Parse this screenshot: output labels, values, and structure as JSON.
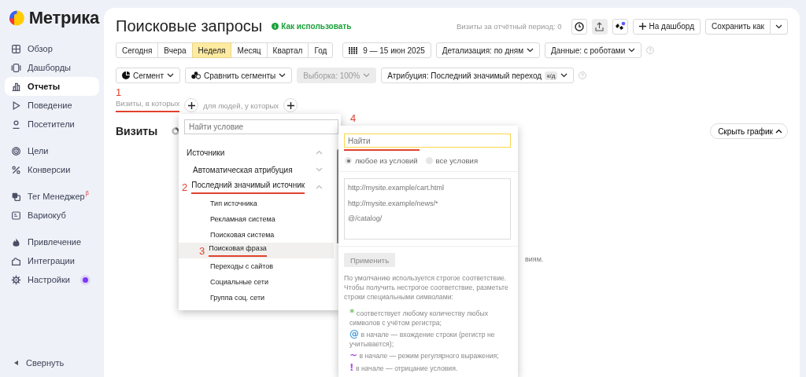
{
  "sidebar": {
    "logo": "Метрика",
    "groups": [
      [
        {
          "label": "Обзор",
          "selected": false,
          "dot": false
        },
        {
          "label": "Дашборды",
          "selected": false,
          "dot": false
        },
        {
          "label": "Отчеты",
          "selected": true,
          "dot": false
        },
        {
          "label": "Поведение",
          "selected": false,
          "dot": false
        },
        {
          "label": "Посетители",
          "selected": false,
          "dot": false
        }
      ],
      [
        {
          "label": "Цели",
          "selected": false,
          "dot": false
        },
        {
          "label": "Конверсии",
          "selected": false,
          "dot": false
        }
      ],
      [
        {
          "label": "Тег Менеджер",
          "selected": false,
          "badge": "β",
          "dot": false
        },
        {
          "label": "Вариокуб",
          "selected": false,
          "dot": false
        }
      ],
      [
        {
          "label": "Привлечение",
          "selected": false,
          "dot": false
        },
        {
          "label": "Интеграции",
          "selected": false,
          "dot": false
        },
        {
          "label": "Настройки",
          "selected": false,
          "dot": true
        }
      ]
    ],
    "collapse": "Свернуть"
  },
  "header": {
    "title": "Поисковые запросы",
    "help_link": "Как использовать",
    "visits_summary": "Визиты за отчётный период: 0",
    "tools": [
      {
        "active": false
      },
      {
        "active": true
      },
      {
        "active": false
      }
    ],
    "add_to_dashboard": "На дашборд",
    "save_as": "Сохранить как"
  },
  "periods": [
    {
      "label": "Сегодня",
      "selected": false
    },
    {
      "label": "Вчера",
      "selected": false
    },
    {
      "label": "Неделя",
      "selected": true
    },
    {
      "label": "Месяц",
      "selected": false
    },
    {
      "label": "Квартал",
      "selected": false
    },
    {
      "label": "Год",
      "selected": false
    }
  ],
  "date_range": "9 — 15 июн 2025",
  "filters": [
    "Детализация: по дням",
    "Данные: с роботами"
  ],
  "segment_bar": [
    {
      "label": "Сегмент",
      "disabled": false
    },
    {
      "label": "Сравнить сегменты",
      "disabled": false
    },
    {
      "label": "Выборка: 100%",
      "disabled": true
    },
    {
      "label": "Атрибуция: Последний значимый переход",
      "disabled": false,
      "badge": "к/д"
    }
  ],
  "conditions": {
    "annotation": "1",
    "visits_label": "Визиты, в которых",
    "people_label": "для людей, у которых"
  },
  "section": {
    "title": "Визиты",
    "hide_chart": "Скрыть график",
    "note": "виям."
  },
  "condition_menu": {
    "search_placeholder": "Найти условие",
    "items": [
      {
        "label": "Источники",
        "expanded": true,
        "children": [
          {
            "label": "Автоматическая атрибуция",
            "expanded": false
          },
          {
            "label": "Последний значимый источник",
            "expanded": true,
            "annotation": "2",
            "children": [
              {
                "label": "Тип источника",
                "selected": false
              },
              {
                "label": "Рекламная система",
                "selected": false
              },
              {
                "label": "Поисковая система",
                "selected": false
              },
              {
                "label": "Поисковая фраза",
                "selected": true,
                "annotation": "3"
              },
              {
                "label": "Переходы с сайтов",
                "selected": false
              },
              {
                "label": "Социальные сети",
                "selected": false
              },
              {
                "label": "Группа соц. сети",
                "selected": false
              }
            ]
          }
        ]
      }
    ]
  },
  "filter_panel": {
    "annotation": "4",
    "search_placeholder": "Найти",
    "match_modes": [
      {
        "label": "любое из условий",
        "selected": true
      },
      {
        "label": "все условия",
        "selected": false
      }
    ],
    "values_placeholder": "http://mysite.example/cart.html\nhttp://mysite.example/news/*\n@/catalog/",
    "apply": "Применить",
    "apply_disabled": true,
    "help": "По умолчанию используется строгое соответствие. Чтобы получить нестрогое соответствие, разметьте строки специальными символами:",
    "rules": [
      {
        "symbol": "*",
        "color": "#7cc36a",
        "text": "соответствует любому количеству любых символов с учётом регистра;"
      },
      {
        "symbol": "@",
        "color": "#4a9fe0",
        "text": "в начале — вхождение строки (регистр не учитывается);"
      },
      {
        "symbol": "~",
        "color": "#a64fd6",
        "text": "в начале — режим регулярного выражения;"
      },
      {
        "symbol": "!",
        "color": "#b44ff0",
        "text": "в начале — отрицание условия."
      }
    ]
  }
}
